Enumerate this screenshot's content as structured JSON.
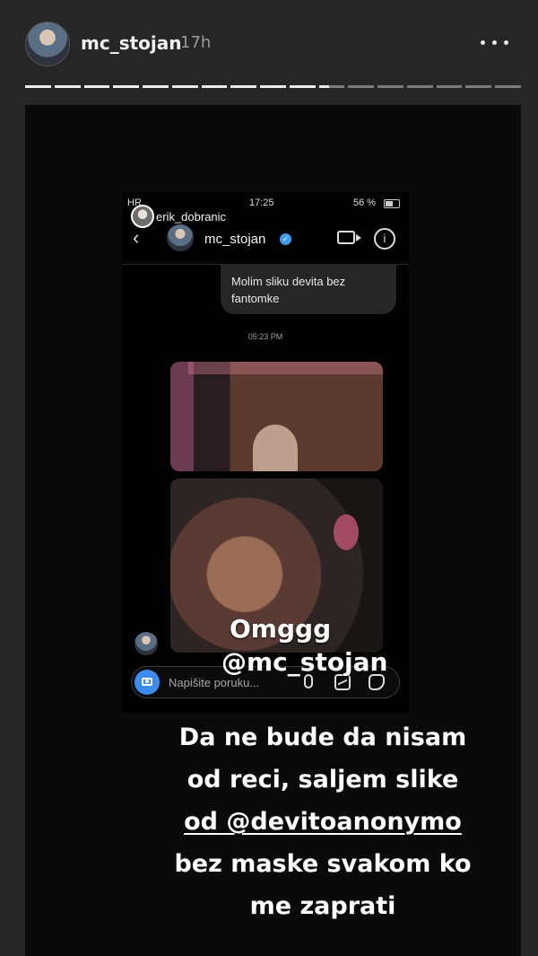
{
  "story": {
    "username": "mc_stojan",
    "time": "17h",
    "progress": {
      "total_segments": 17,
      "completed": 10,
      "current": 11
    }
  },
  "screenshot": {
    "status_bar": {
      "signal": "HR",
      "clock": "17:25",
      "battery": "56 %"
    },
    "mention_sticker_name": "erik_dobranic",
    "chat_header_name": "mc_stojan",
    "message_bubble": "Molim sliku devita bez fantomke",
    "message_time": "05:23 PM",
    "composer_placeholder": "Napišite poruku..."
  },
  "overlays": {
    "omggg": "Omggg",
    "mention": "@mc_stojan",
    "caption_lines": [
      "Da ne bude da nisam",
      "od reci, saljem slike",
      "od @devitoanonymo",
      "bez maske svakom ko",
      "me zaprati"
    ]
  },
  "icons": [
    "more-icon",
    "back-icon",
    "verified-icon",
    "video-call-icon",
    "info-icon",
    "camera-icon",
    "microphone-icon",
    "gallery-icon",
    "sticker-icon"
  ]
}
